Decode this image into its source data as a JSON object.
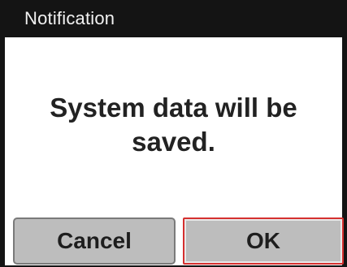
{
  "dialog": {
    "title": "Notification",
    "message": "System data will be saved.",
    "buttons": {
      "cancel_label": "Cancel",
      "ok_label": "OK"
    },
    "colors": {
      "titlebar": "#141414",
      "button": "#bdbdbd",
      "focus_border": "#d5302f"
    }
  }
}
